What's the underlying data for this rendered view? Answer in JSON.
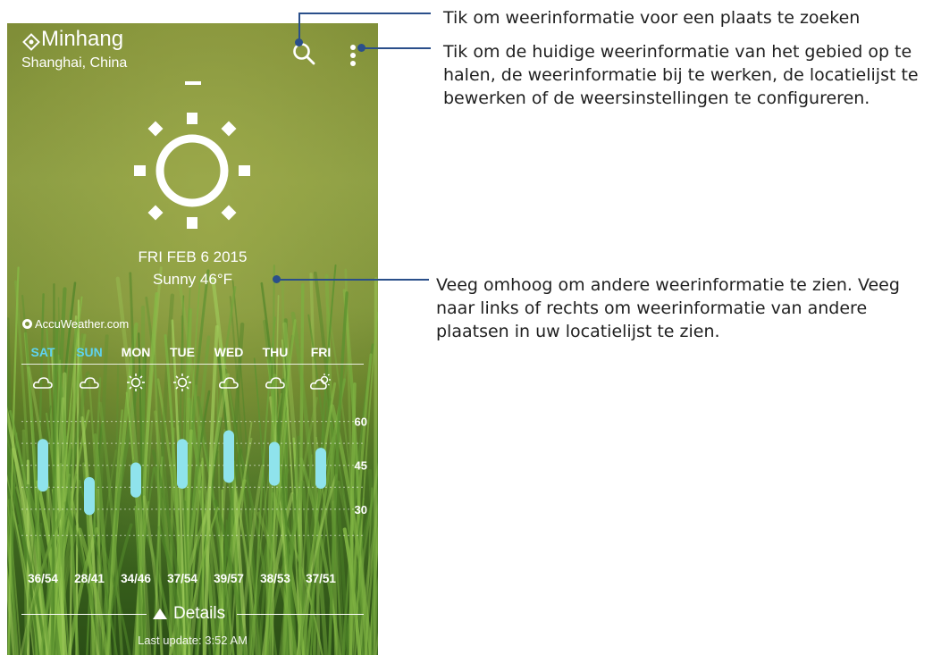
{
  "app": {
    "location": "Minhang",
    "region": "Shanghai, China",
    "date": "FRI FEB 6 2015",
    "condition": "Sunny 46°F",
    "provider": "AccuWeather.com",
    "details_label": "Details",
    "last_update": "Last update: 3:52 AM",
    "weather_icon": "sun-icon"
  },
  "forecast": {
    "days": [
      {
        "label": "SAT",
        "icon": "cloud-icon",
        "range": "36/54"
      },
      {
        "label": "SUN",
        "icon": "cloud-icon",
        "range": "28/41"
      },
      {
        "label": "MON",
        "icon": "sun-icon",
        "range": "34/46"
      },
      {
        "label": "TUE",
        "icon": "sun-icon",
        "range": "37/54"
      },
      {
        "label": "WED",
        "icon": "cloud-icon",
        "range": "39/57"
      },
      {
        "label": "THU",
        "icon": "cloud-icon",
        "range": "38/53"
      },
      {
        "label": "FRI",
        "icon": "partly-sunny-icon",
        "range": "37/51"
      }
    ],
    "weekend_color": "#5fd3f0",
    "weekday_color": "#ffffff"
  },
  "chart_data": {
    "type": "bar",
    "categories": [
      "SAT",
      "SUN",
      "MON",
      "TUE",
      "WED",
      "THU",
      "FRI"
    ],
    "series": [
      {
        "low": [
          36,
          28,
          34,
          37,
          39,
          38,
          37
        ],
        "high": [
          54,
          41,
          46,
          54,
          57,
          53,
          51
        ]
      }
    ],
    "yticks": [
      30,
      45,
      60
    ],
    "ylim": [
      22,
      66
    ],
    "bar_color": "#8fe3ec",
    "grid": true
  },
  "annotations": [
    {
      "text": "Tik om weerinformatie voor een plaats te zoeken"
    },
    {
      "text": "Tik om de huidige weerinformatie van het gebied op te halen, de weerinformatie bij te werken, de locatielijst te bewerken of de weersinstellingen te configureren."
    },
    {
      "text": "Veeg omhoog om andere weerinformatie te zien. Veeg naar links of rechts om weerinformatie van andere plaatsen in uw locatielijst te zien."
    }
  ]
}
